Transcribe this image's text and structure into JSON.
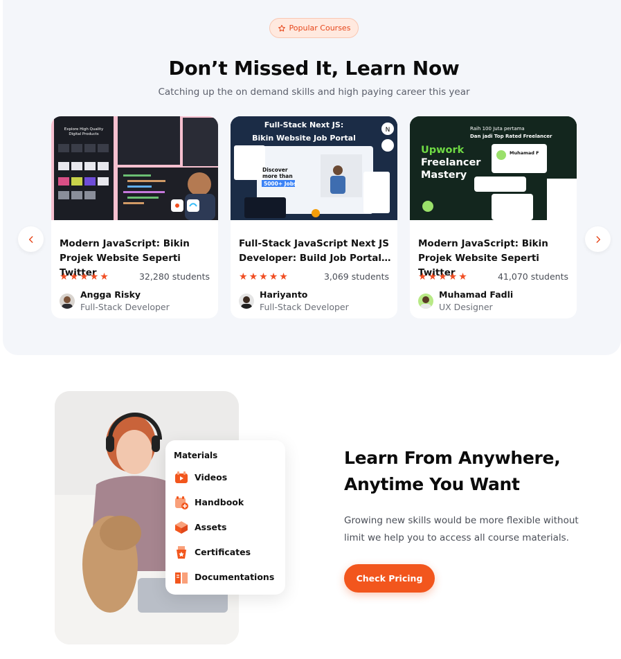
{
  "section_courses": {
    "badge": "Popular Courses",
    "title": "Don’t Missed It, Learn Now",
    "subtitle": "Catching up the on demand skills and high paying career this year",
    "cards": [
      {
        "title": "Modern JavaScript: Bikin Projek Website Seperti Twitter",
        "students": "32,280 students",
        "instructor": "Angga Risky",
        "role": "Full-Stack Developer",
        "thumb_text": [
          "Explore High Quality",
          "Digital Products"
        ]
      },
      {
        "title": "Full-Stack JavaScript Next JS Developer: Build Job Portal…",
        "students": "3,069 students",
        "instructor": "Hariyanto",
        "role": "Full-Stack Developer",
        "thumb_text": [
          "Full-Stack Next JS:",
          "Bikin Website Job Portal",
          "Discover",
          "more than",
          "5000+ Jobs"
        ]
      },
      {
        "title": "Modern JavaScript: Bikin Projek Website Seperti Twitter",
        "students": "41,070 students",
        "instructor": "Muhamad Fadli",
        "role": "UX Designer",
        "thumb_text": [
          "Upwork",
          "Freelancer",
          "Mastery",
          "Raih 100 Juta pertama",
          "Dan jadi Top Rated Freelancer",
          "Muhamad F"
        ]
      }
    ],
    "rating_stars": 5
  },
  "section_anywhere": {
    "materials_title": "Materials",
    "materials": [
      "Videos",
      "Handbook",
      "Assets",
      "Certificates",
      "Documentations"
    ],
    "title_line1": "Learn From Anywhere,",
    "title_line2": "Anytime You Want",
    "description_line1": "Growing new skills would be more flexible without",
    "description_line2": "limit we help you to access all course materials.",
    "cta": "Check Pricing"
  },
  "colors": {
    "accent": "#f2561d",
    "star": "#f04e23",
    "section_bg": "#f4f6fa"
  },
  "icons": [
    "star-outline-icon",
    "chevron-left-icon",
    "chevron-right-icon",
    "video-icon",
    "handbook-icon",
    "assets-icon",
    "certificate-icon",
    "documentation-icon"
  ]
}
